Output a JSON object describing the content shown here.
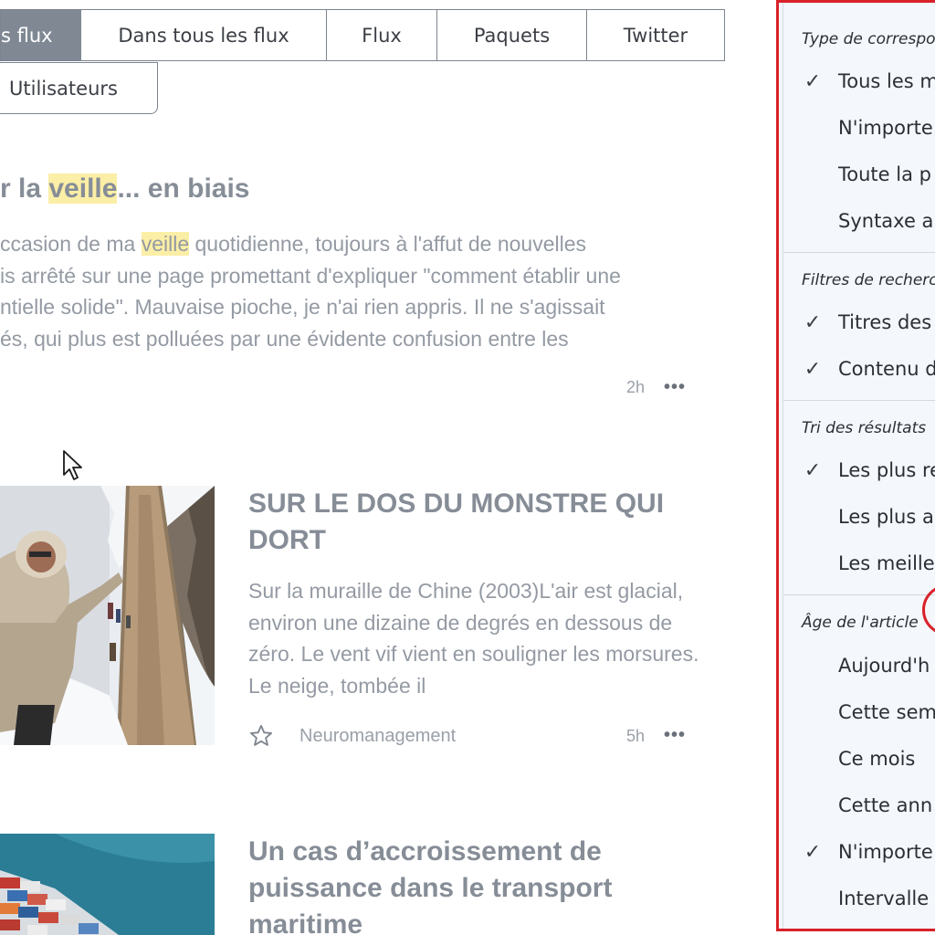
{
  "tabs": [
    {
      "label": "s flux",
      "active": true
    },
    {
      "label": "Dans tous les flux"
    },
    {
      "label": "Flux"
    },
    {
      "label": "Paquets"
    },
    {
      "label": "Twitter"
    }
  ],
  "users_tab": "Utilisateurs",
  "articles": [
    {
      "title_pre": "r la ",
      "title_hl": "veille",
      "title_post": "... en biais",
      "lines": [
        [
          "ccasion de ma ",
          "veille",
          " quotidienne, toujours à l'affut de nouvelles"
        ],
        [
          "is arrêté sur une page promettant d'expliquer \"comment établir une"
        ],
        [
          "ntielle solide\". Mauvaise pioche, je n'ai rien appris. Il ne s'agissait"
        ],
        [
          "és, qui plus est polluées par une évidente confusion entre les"
        ]
      ],
      "time": "2h"
    },
    {
      "title": "SUR LE DOS DU MONSTRE QUI DORT",
      "body": "Sur la muraille de Chine (2003)L'air est glacial, environ une dizaine de degrés en dessous de zéro. Le vent vif vient en souligner les morsures. Le neige, tombée il",
      "source": "Neuromanagement",
      "time": "5h"
    },
    {
      "title": "Un cas d’accroissement de puissance dans le transport maritime"
    }
  ],
  "dots": "•••",
  "dropdown": {
    "sections": [
      {
        "header": "Type de correspo",
        "options": [
          {
            "label": "Tous les m",
            "checked": true
          },
          {
            "label": "N'importe",
            "checked": false
          },
          {
            "label": "Toute la p",
            "checked": false
          },
          {
            "label": "Syntaxe a",
            "checked": false
          }
        ]
      },
      {
        "header": "Filtres de recherc",
        "options": [
          {
            "label": "Titres des",
            "checked": true
          },
          {
            "label": "Contenu d",
            "checked": true
          }
        ]
      },
      {
        "header": "Tri des résultats",
        "options": [
          {
            "label": "Les plus re",
            "checked": true
          },
          {
            "label": "Les plus a",
            "checked": false
          },
          {
            "label": "Les meille",
            "checked": false
          }
        ]
      },
      {
        "header": "Âge de l'article",
        "options": [
          {
            "label": "Aujourd'h",
            "checked": false
          },
          {
            "label": "Cette sem",
            "checked": false
          },
          {
            "label": "Ce mois",
            "checked": false
          },
          {
            "label": "Cette ann",
            "checked": false
          },
          {
            "label": "N'importe",
            "checked": true
          },
          {
            "label": "Intervalle",
            "checked": false
          }
        ]
      }
    ]
  },
  "colors": {
    "accent_red": "#d9212a",
    "tab_active": "#7f8893",
    "highlight": "#fbeea6"
  }
}
